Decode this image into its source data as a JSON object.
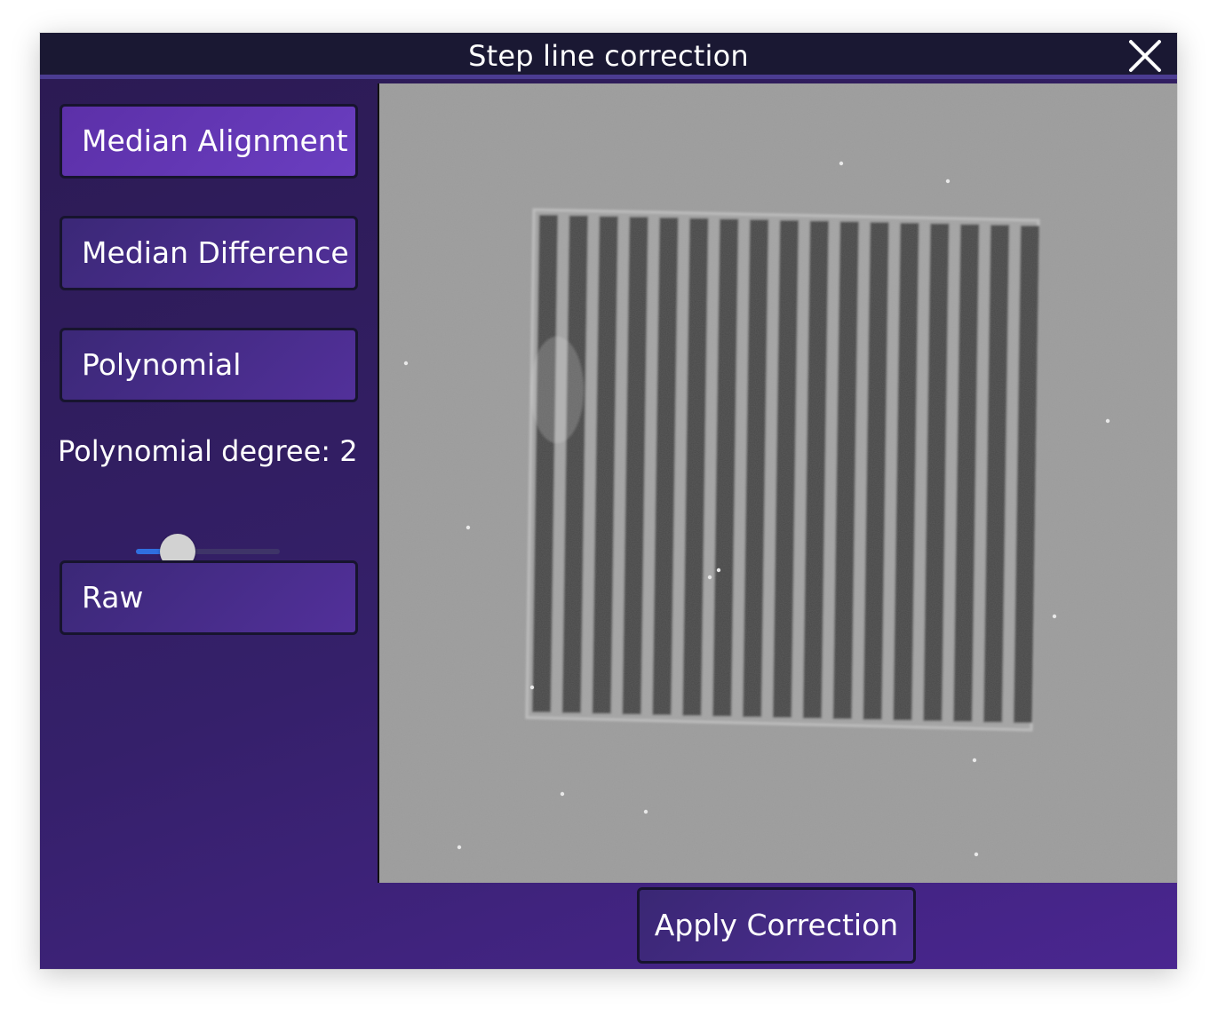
{
  "dialog": {
    "title": "Step line correction",
    "close_icon": "close-icon"
  },
  "sidebar": {
    "buttons": [
      {
        "label": "Median Alignment",
        "active": true
      },
      {
        "label": "Median Difference",
        "active": false
      },
      {
        "label": "Polynomial",
        "active": false
      }
    ],
    "polynomial": {
      "label": "Polynomial degree: 2",
      "degree": 2,
      "slider_fraction": 0.29
    },
    "raw_label": "Raw"
  },
  "preview": {
    "description_icon": "afm-grating-image",
    "stripe_count": 17
  },
  "footer": {
    "apply_label": "Apply Correction"
  },
  "colors": {
    "accent_active": "#6a3ec0",
    "slider_fill": "#2f6fe0",
    "titlebar": "#1a1833"
  }
}
